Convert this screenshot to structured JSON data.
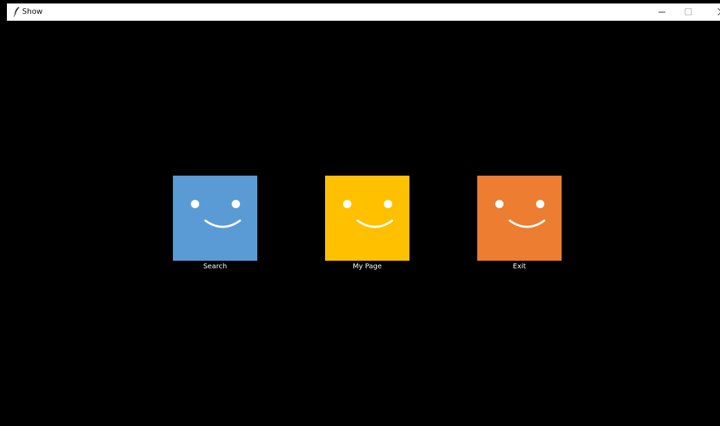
{
  "window": {
    "title": "Show",
    "icon": "feather-icon",
    "controls": [
      "minimize-icon",
      "maximize-icon",
      "close-icon"
    ]
  },
  "tiles": [
    {
      "label": "Search",
      "color": "#5b9bd5",
      "icon": "smiley-face-icon"
    },
    {
      "label": "My Page",
      "color": "#ffc000",
      "icon": "smiley-face-icon"
    },
    {
      "label": "Exit",
      "color": "#ed7d31",
      "icon": "smiley-face-icon"
    }
  ],
  "colors": {
    "background": "#000000",
    "titlebar": "#ffffff",
    "label_text": "#ffffff"
  }
}
